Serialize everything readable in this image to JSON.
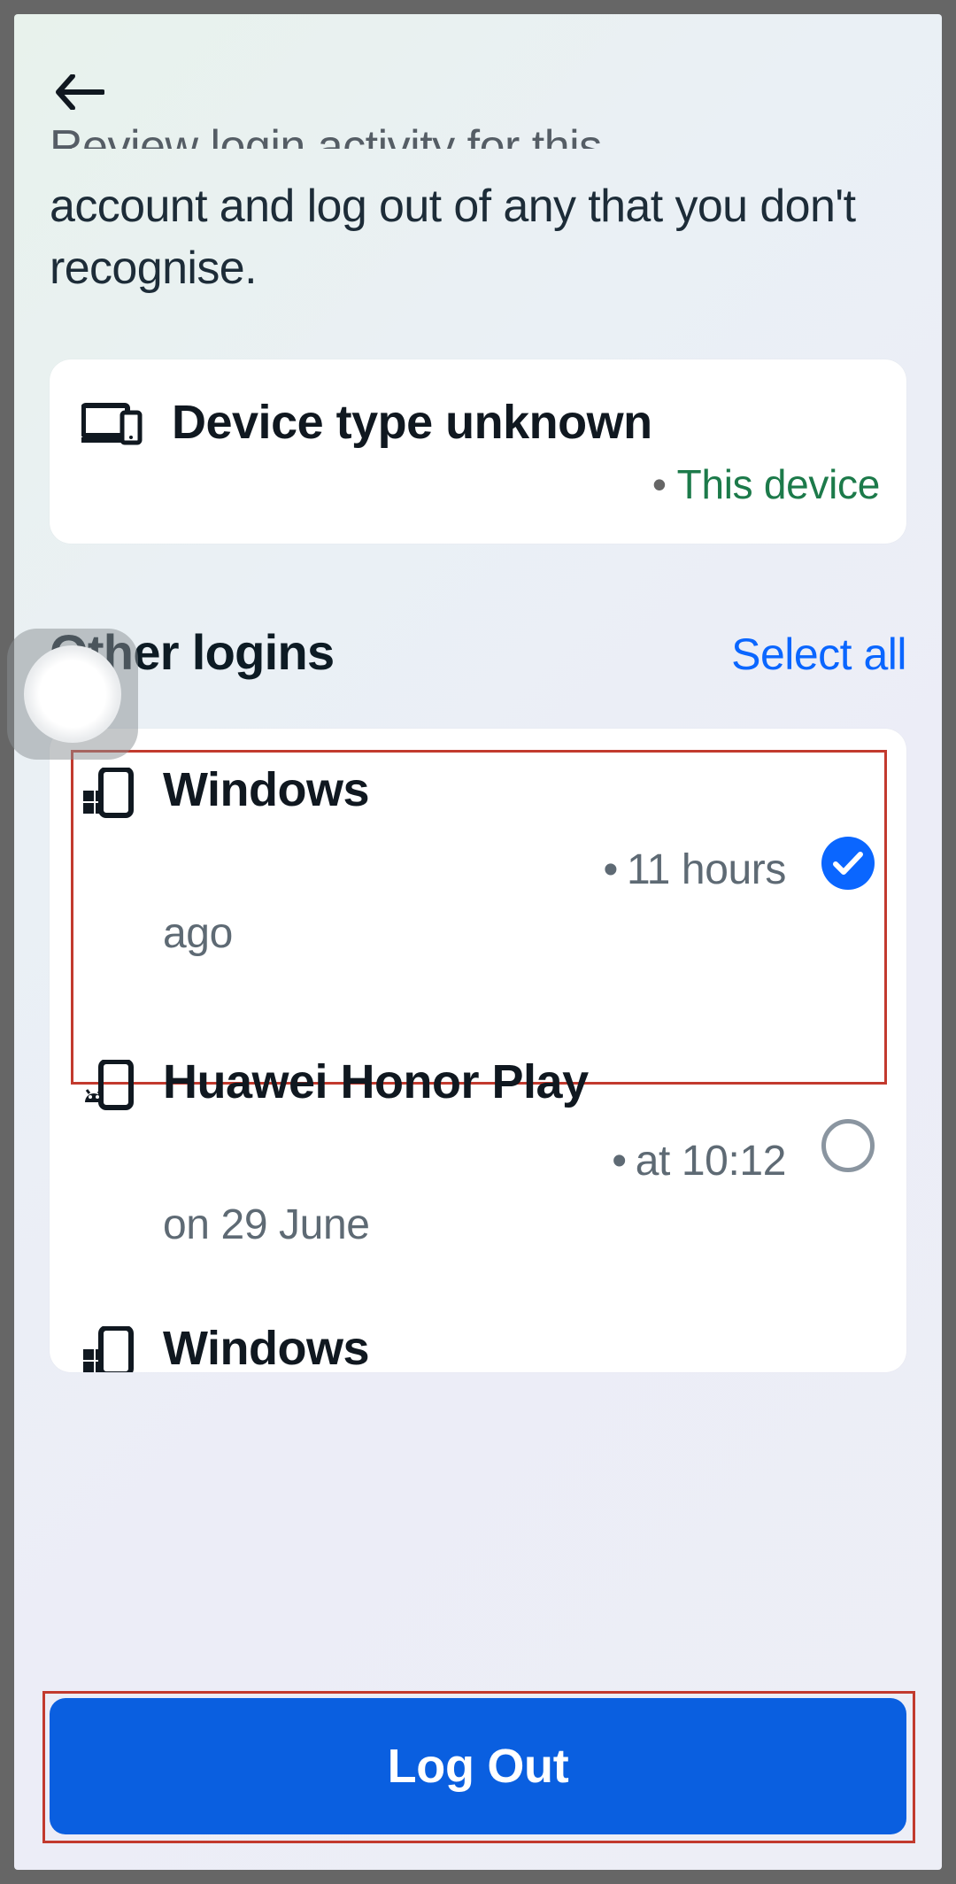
{
  "header": {
    "back_aria": "Back"
  },
  "description": {
    "cut_line": "Review login activity for this",
    "line": "account and log out of any that you don't recognise."
  },
  "current_device": {
    "title": "Device type unknown",
    "badge": "This device"
  },
  "section": {
    "title": "Other logins",
    "select_all": "Select all"
  },
  "logins": [
    {
      "name": "Windows",
      "detail_lead": "11 hours",
      "detail_tail": "ago",
      "selected": true,
      "icon": "windows-phone"
    },
    {
      "name": "Huawei Honor Play",
      "detail_lead": "at 10:12",
      "detail_tail": "on 29 June",
      "selected": false,
      "icon": "android-phone"
    },
    {
      "name": "Windows",
      "detail_lead": "",
      "detail_tail": "",
      "selected": false,
      "icon": "windows-phone"
    }
  ],
  "footer": {
    "logout": "Log Out"
  }
}
